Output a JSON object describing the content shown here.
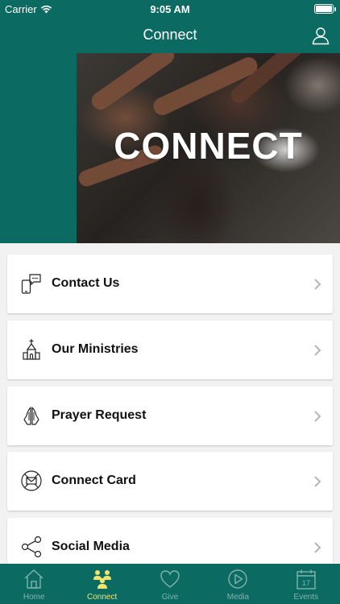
{
  "status_bar": {
    "carrier": "Carrier",
    "time": "9:05 AM"
  },
  "header": {
    "title": "Connect",
    "profile_icon": "user-icon"
  },
  "hero": {
    "text": "CONNECT"
  },
  "menu": [
    {
      "label": "Contact Us",
      "icon": "phone-chat-icon"
    },
    {
      "label": "Our Ministries",
      "icon": "church-icon"
    },
    {
      "label": "Prayer Request",
      "icon": "praying-hands-icon"
    },
    {
      "label": "Connect Card",
      "icon": "envelope-card-icon"
    },
    {
      "label": "Social Media",
      "icon": "share-icon"
    }
  ],
  "tabs": [
    {
      "label": "Home",
      "icon": "home-icon",
      "active": false
    },
    {
      "label": "Connect",
      "icon": "people-icon",
      "active": true
    },
    {
      "label": "Give",
      "icon": "heart-icon",
      "active": false
    },
    {
      "label": "Media",
      "icon": "play-icon",
      "active": false
    },
    {
      "label": "Events",
      "icon": "calendar-icon",
      "active": false
    }
  ],
  "colors": {
    "primary": "#0b6b63",
    "active_tab": "#f1e46a",
    "inactive_tab": "#7fb3ad"
  },
  "events_calendar_day": "17"
}
